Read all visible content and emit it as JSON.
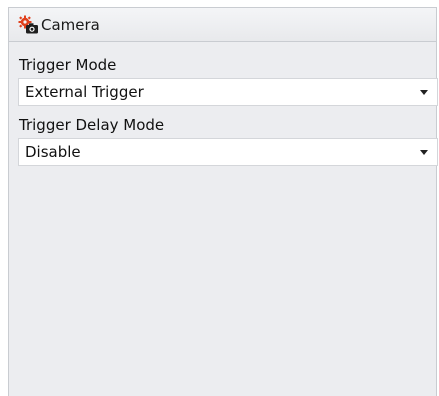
{
  "panel": {
    "title": "Camera",
    "icon": "camera-settings-icon",
    "accent_color": "#e0401c"
  },
  "fields": [
    {
      "label": "Trigger Mode",
      "value": "External Trigger"
    },
    {
      "label": "Trigger Delay Mode",
      "value": "Disable"
    }
  ]
}
